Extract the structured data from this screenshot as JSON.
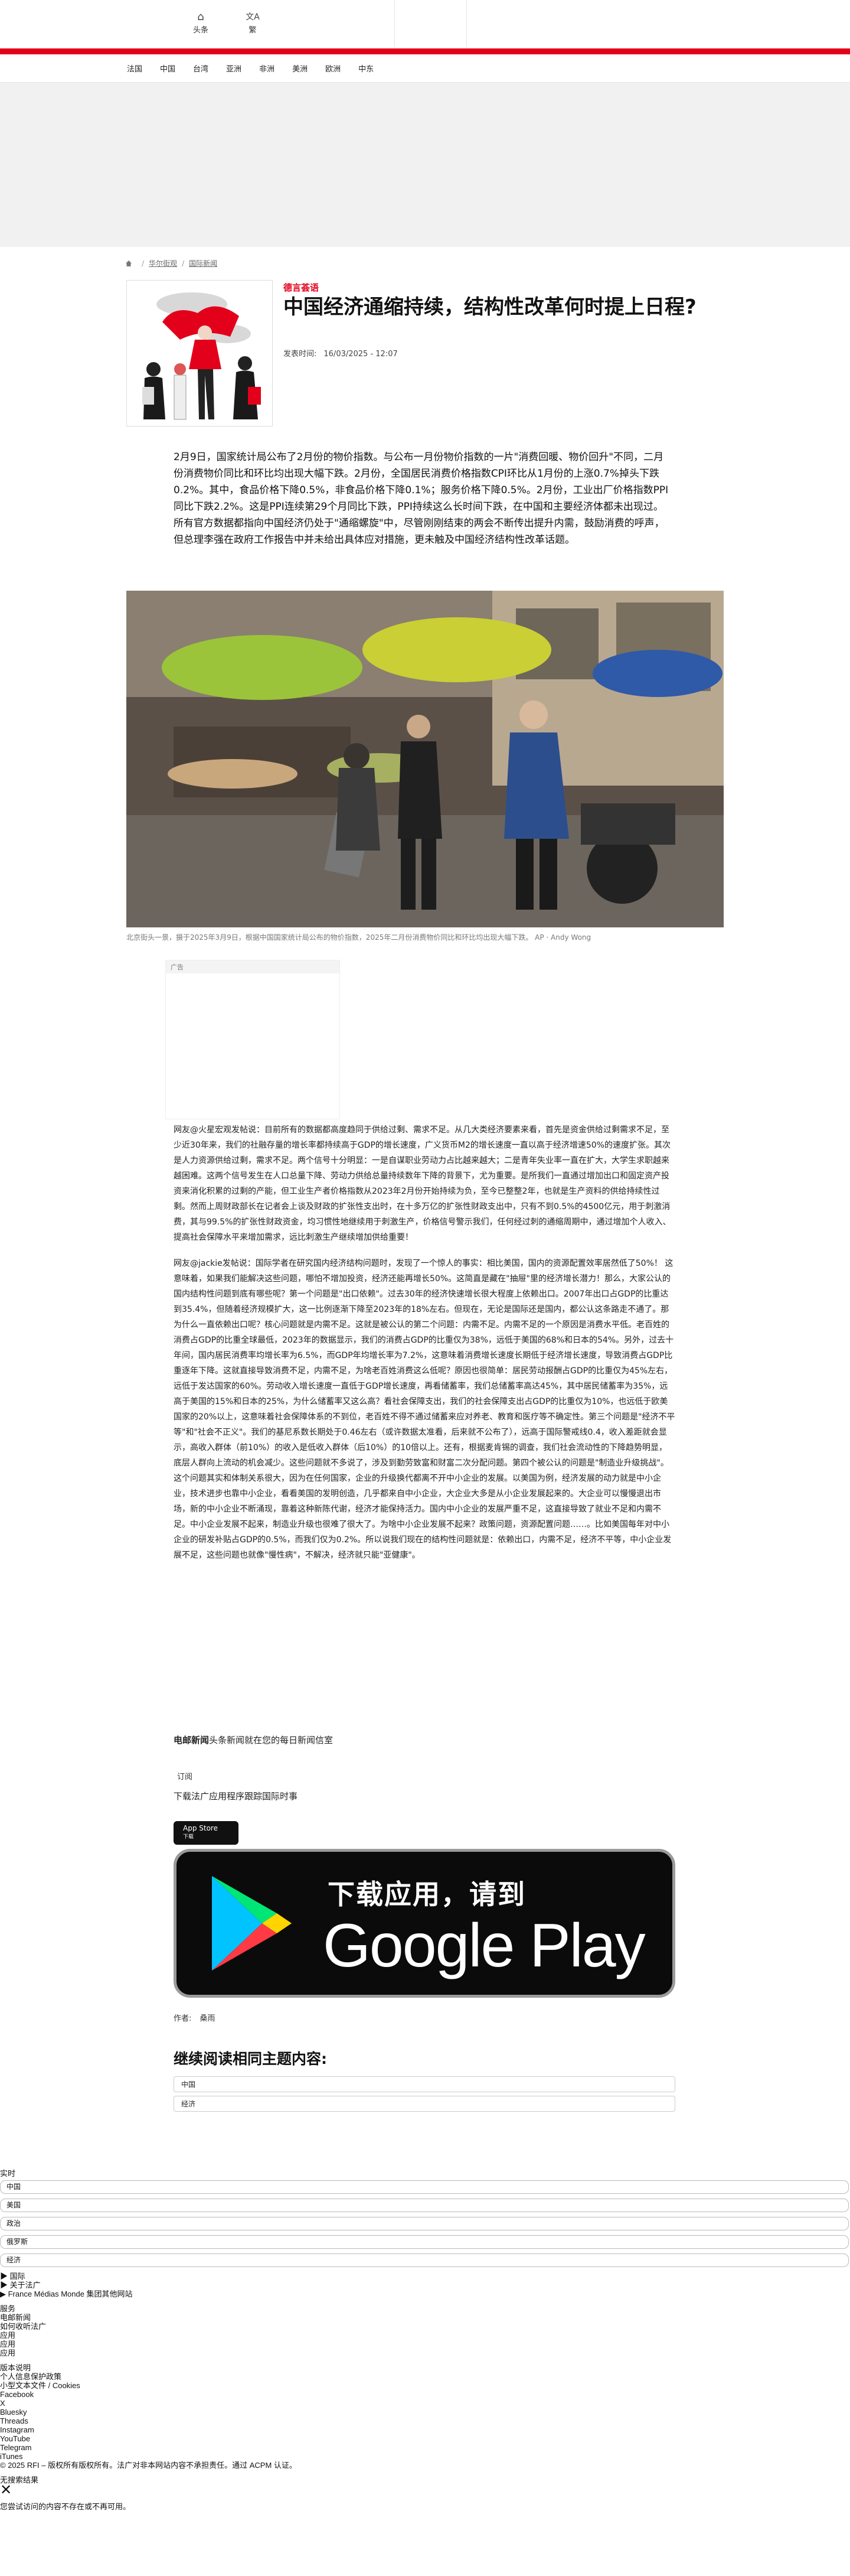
{
  "header": {
    "home_label": "头条",
    "lang_label": "繁",
    "nav": [
      "法国",
      "中国",
      "台湾",
      "亚洲",
      "非洲",
      "美洲",
      "欧洲",
      "中东"
    ]
  },
  "breadcrumb": [
    "华尔街观",
    "国际新闻"
  ],
  "article": {
    "kicker": "德言荟语",
    "title": "中国经济通缩持续，结构性改革何时提上日程?",
    "published_label": "发表时间:",
    "published_value": "16/03/2025 - 12:07",
    "lead": "2月9日，国家统计局公布了2月份的物价指数。与公布一月份物价指数的一片\"消费回暖、物价回升\"不同，二月份消费物价同比和环比均出现大幅下跌。2月份，全国居民消费价格指数CPI环比从1月份的上涨0.7%掉头下跌0.2%。其中，食品价格下降0.5%，非食品价格下降0.1%；服务价格下降0.5%。2月份，工业出厂价格指数PPI同比下跌2.2%。这是PPI连续第29个月同比下跌，PPI持续这么长时间下跌，在中国和主要经济体都未出现过。所有官方数据都指向中国经济仍处于\"通缩螺旋\"中，尽管刚刚结束的两会不断传出提升内需，鼓励消费的呼声，但总理李强在政府工作报告中并未给出具体应对措施，更未触及中国经济结构性改革话题。",
    "photo_caption": "北京街头一景，摄于2025年3月9日，根据中国国家统计局公布的物价指数，2025年二月份消费物价同比和环比均出现大幅下跌。 AP · Andy Wong",
    "ad_label": "广告",
    "paragraphs": [
      "网友@火星宏观发帖说：目前所有的数据都高度趋同于供给过剩、需求不足。从几大类经济要素来看，首先是资金供给过剩需求不足，至少近30年来，我们的社融存量的增长率都持续高于GDP的增长速度，广义货币M2的增长速度一直以高于经济增速50%的速度扩张。其次是人力资源供给过剩，需求不足。两个信号十分明显：一是自谋职业劳动力占比越来越大；二是青年失业率一直在扩大，大学生求职越来越困难。这两个信号发生在人口总量下降、劳动力供给总量持续数年下降的背景下，尤为重要。是所我们一直通过增加出口和固定资产投资来消化积累的过剩的产能，但工业生产者价格指数从2023年2月份开始持续为负，至今已整整2年，也就是生产资料的供给持续性过剩。然而上周财政部长在记者会上谈及财政的扩张性支出时，在十多万亿的扩张性财政支出中，只有不到0.5%的4500亿元，用于刺激消费，其与99.5%的扩张性财政资金，均习惯性地继续用于刺激生产，价格信号警示我们，任何经过刺的通缩周期中，通过增加个人收入、提高社会保障水平来增加需求，远比刺激生产继续增加供给重要！",
      "网友@jackie发帖说：国际学者在研究国内经济结构问题时，发现了一个惊人的事实：相比美国，国内的资源配置效率居然低了50%！ 这意味着，如果我们能解决这些问题，哪怕不增加投资，经济还能再增长50%。这简直是藏在\"抽屉\"里的经济增长潜力！那么，大家公认的国内结构性问题到底有哪些呢？第一个问题是\"出口依赖\"。过去30年的经济快速增长很大程度上依赖出口。2007年出口占GDP的比重达到35.4%，但随着经济规模扩大，这一比例逐渐下降至2023年的18%左右。但现在，无论是国际还是国内，都公认这条路走不通了。那为什么一直依赖出口呢？核心问题就是内需不足。这就是被公认的第二个问题：内需不足。内需不足的一个原因是消费水平低。老百姓的消费占GDP的比重全球最低，2023年的数据显示，我们的消费占GDP的比重仅为38%，远低于美国的68%和日本的54%。另外，过去十年间，国内居民消费率均增长率为6.5%，而GDP年均增长率为7.2%，这意味着消费增长速度长期低于经济增长速度，导致消费占GDP比重逐年下降。这就直接导致消费不足，内需不足，为啥老百姓消费这么低呢？原因也很简单：居民劳动报酬占GDP的比重仅为45%左右，远低于发达国家的60%。劳动收入增长速度一直低于GDP增长速度，再看储蓄率，我们总储蓄率高达45%，其中居民储蓄率为35%，远高于美国的15%和日本的25%，为什么储蓄率又这么高？看社会保障支出，我们的社会保障支出占GDP的比重仅为10%，也远低于欧美国家的20%以上，这意味着社会保障体系的不到位，老百姓不得不通过储蓄来应对养老、教育和医疗等不确定性。第三个问题是\"经济不平等\"和\"社会不正义\"。我们的基尼系数长期处于0.46左右（或许数据太准看，后来就不公布了），远高于国际警戒线0.4，收入差距就会显示，高收入群体（前10%）的收入是低收入群体（后10%）的10倍以上。还有，根据麦肯锡的调查，我们社会流动性的下降趋势明显，底层人群向上流动的机会减少。这些问题就不多说了，涉及到勤劳致富和财富二次分配问题。第四个被公认的问题是\"制造业升级挑战\"。这个问题其实和体制关系很大，因为在任何国家，企业的升级换代都离不开中小企业的发展。以美国为例，经济发展的动力就是中小企业，技术进步也靠中小企业，看看美国的发明创造，几乎都来自中小企业，大企业大多是从小企业发展起来的。大企业可以慢慢退出市场，新的中小企业不断涌现，靠着这种新陈代谢，经济才能保持活力。国内中小企业的发展严重不足，这直接导致了就业不足和内需不足。中小企业发展不起来，制造业升级也很难了很大了。为啥中小企业发展不起来？政策问题，资源配置问题……。比如美国每年对中小企业的研发补贴占GDP的0.5%，而我们仅为0.2%。所以说我们现在的结构性问题就是：依赖出口，内需不足，经济不平等，中小企业发展不足，这些问题也就像\"慢性病\"，不解决，经济就只能\"亚健康\"。"
    ],
    "promo_strong": "电邮新闻",
    "promo_rest": "头条新闻就在您的每日新闻信室",
    "subscribe_label": "订阅",
    "download_label": "下载法广应用程序跟踪国际时事",
    "appstore_small": "App Store",
    "appstore_big": "下载",
    "gplay_line1": "下载应用，请到",
    "gplay_line2": "Google Play",
    "author_label": "作者:",
    "author_name": "桑雨",
    "related_title": "继续阅读相同主题内容:",
    "related_tags": [
      "中国",
      "经济"
    ]
  },
  "footer": {
    "live_label": "实时",
    "live_pills": [
      "中国",
      "美国",
      "政治",
      "俄罗斯",
      "经济"
    ],
    "lines_a": [
      "▶ 国际",
      "▶ 关于法广",
      "▶ France Médias Monde 集团其他网站"
    ],
    "lines_b": [
      "服务",
      "电邮新闻",
      "如何收听法广",
      "应用",
      "应用",
      "应用"
    ],
    "lines_c": [
      "版本说明",
      "个人信息保护政策",
      "小型文本文件 / Cookies",
      "Facebook",
      "X",
      "Bluesky",
      "Threads",
      "Instagram",
      "YouTube",
      "Telegram",
      "iTunes",
      "© 2025 RFI – 版权所有版权所有。法广对非本网站内容不承担责任。通过 ACPM 认证。"
    ],
    "no_result": "无搜索结果",
    "not_found": "您尝试访问的内容不存在或不再可用。"
  },
  "colors": {
    "accent": "#e3001b",
    "kicker": "#e3001b"
  }
}
